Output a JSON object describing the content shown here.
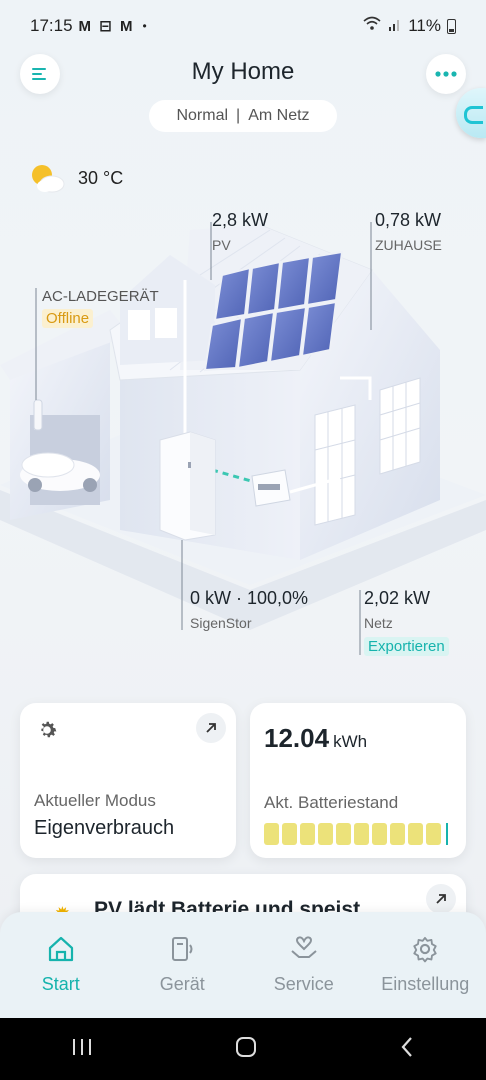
{
  "status_bar": {
    "time": "17:15",
    "notifications": "M ⊟ M",
    "dot": "•",
    "battery": "11%"
  },
  "header": {
    "title": "My Home",
    "mode": "Normal",
    "separator": "|",
    "grid_status": "Am Netz"
  },
  "weather": {
    "temperature": "30 °C"
  },
  "energy_flow": {
    "pv": {
      "value": "2,8 kW",
      "label": "PV"
    },
    "home": {
      "value": "0,78 kW",
      "label": "ZUHAUSE"
    },
    "charger": {
      "label": "AC-LADEGERÄT",
      "status": "Offline"
    },
    "storage": {
      "value": "0 kW · 100,0%",
      "label": "SigenStor"
    },
    "grid": {
      "value": "2,02 kW",
      "label": "Netz",
      "status": "Exportieren"
    }
  },
  "cards": {
    "mode": {
      "caption": "Aktueller Modus",
      "value": "Eigenverbrauch"
    },
    "battery": {
      "amount": "12.04",
      "unit": "kWh",
      "caption": "Akt. Batteriestand",
      "level_pct": 100
    },
    "pv": {
      "text": "PV lädt Batterie und speist"
    }
  },
  "nav": {
    "items": [
      {
        "label": "Start"
      },
      {
        "label": "Gerät"
      },
      {
        "label": "Service"
      },
      {
        "label": "Einstellung"
      }
    ]
  },
  "colors": {
    "accent": "#16b3ad",
    "offline": "#d99a13",
    "battery_fill": "#ece27a"
  }
}
